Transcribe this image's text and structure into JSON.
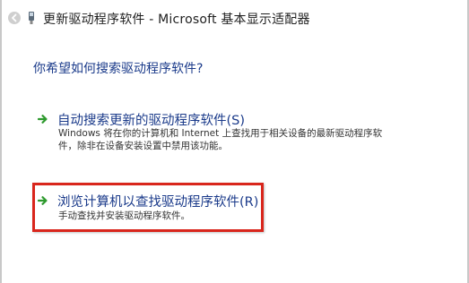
{
  "window": {
    "title": "更新驱动程序软件 - Microsoft 基本显示适配器"
  },
  "prompt": {
    "question": "你希望如何搜索驱动程序软件?"
  },
  "options": [
    {
      "title": "自动搜索更新的驱动程序软件(S)",
      "description_line1": "Windows 将在你的计算机和 Internet 上查找用于相关设备的最新驱动程序软",
      "description_line2": "件，除非在设备安装设置中禁用该功能。"
    },
    {
      "title": "浏览计算机以查找驱动程序软件(R)",
      "description_line1": "手动查找并安装驱动程序软件。"
    }
  ],
  "colors": {
    "option_text": "#1a3a8a",
    "arrow_green": "#2e9a2e",
    "highlight_border": "#d9261c"
  },
  "icons": {
    "back": "back-arrow-icon",
    "app": "device-manager-icon",
    "option_arrow": "green-arrow-icon"
  }
}
